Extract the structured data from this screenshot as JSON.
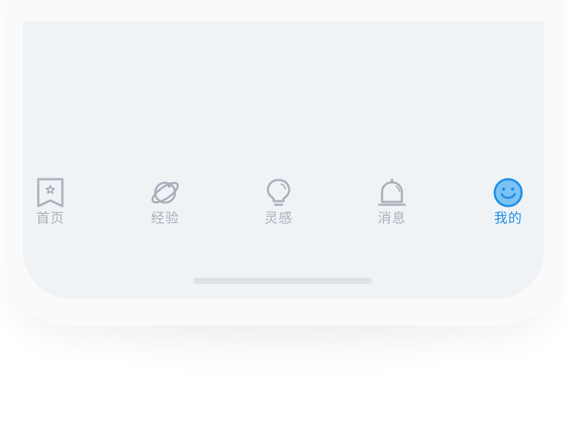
{
  "tab_bar": {
    "items": [
      {
        "label": "首页",
        "icon": "home-bookmark-icon",
        "active": false
      },
      {
        "label": "经验",
        "icon": "planet-icon",
        "active": false
      },
      {
        "label": "灵感",
        "icon": "lightbulb-icon",
        "active": false
      },
      {
        "label": "消息",
        "icon": "bell-icon",
        "active": false
      },
      {
        "label": "我的",
        "icon": "smiley-face-icon",
        "active": true
      }
    ]
  },
  "colors": {
    "screen_background": "#f0f3f6",
    "inactive": "#aab0bb",
    "active": "#1e8fe8",
    "home_indicator": "#dde1e8"
  }
}
